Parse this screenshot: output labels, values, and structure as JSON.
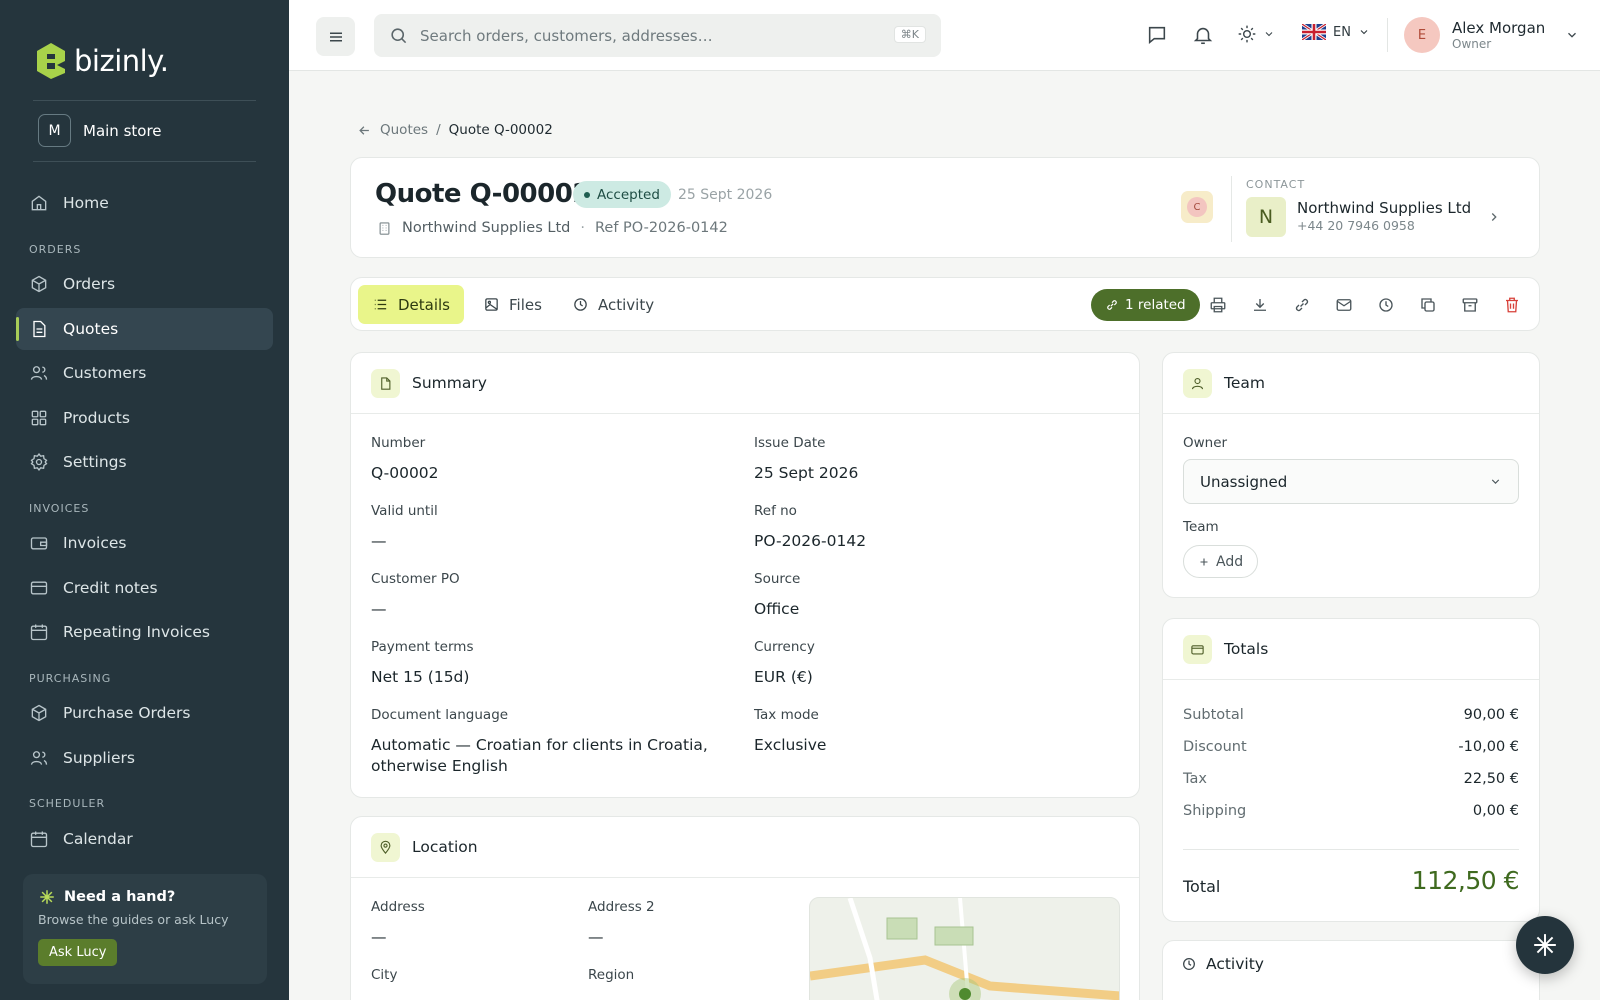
{
  "sidebar": {
    "brand": "bizinly.",
    "store": {
      "initial": "M",
      "name": "Main store"
    },
    "home": "Home",
    "sections": {
      "orders": "ORDERS",
      "invoices": "INVOICES",
      "purchasing": "PURCHASING",
      "scheduler": "SCHEDULER"
    },
    "items": {
      "orders": "Orders",
      "quotes": "Quotes",
      "customers": "Customers",
      "products": "Products",
      "settings": "Settings",
      "invoices": "Invoices",
      "credit_notes": "Credit notes",
      "repeating_invoices": "Repeating Invoices",
      "purchase_orders": "Purchase Orders",
      "suppliers": "Suppliers",
      "calendar": "Calendar"
    },
    "active_item": "Quotes",
    "help": {
      "title": "Need a hand?",
      "subtitle": "Browse the guides or ask Lucy",
      "button": "Ask Lucy"
    }
  },
  "topbar": {
    "search_placeholder": "Search orders, customers, addresses…",
    "search_shortcut": "⌘K",
    "language": "EN",
    "user": {
      "initial": "E",
      "name": "Alex Morgan",
      "role": "Owner"
    }
  },
  "breadcrumb": {
    "parent": "Quotes",
    "separator": "/",
    "current": "Quote Q-00002"
  },
  "quote": {
    "title": "Quote Q-00002",
    "status": "Accepted",
    "date": "25 Sept 2026",
    "company": "Northwind Supplies Ltd",
    "separator": "·",
    "reference": "Ref PO-2026-0142",
    "creator_initial": "C"
  },
  "contact": {
    "label": "CONTACT",
    "initial": "N",
    "name": "Northwind Supplies Ltd",
    "phone": "+44 20 7946 0958"
  },
  "tabs": {
    "details": "Details",
    "files": "Files",
    "activity": "Activity",
    "active": "Details"
  },
  "actions": {
    "related": "1 related",
    "icons": [
      "printer-icon",
      "download-icon",
      "link-icon",
      "mail-icon",
      "clock-icon",
      "copy-icon",
      "archive-icon",
      "trash-icon"
    ]
  },
  "summary": {
    "title": "Summary",
    "fields": {
      "number": {
        "label": "Number",
        "value": "Q-00002"
      },
      "issue_date": {
        "label": "Issue Date",
        "value": "25 Sept 2026"
      },
      "valid_until": {
        "label": "Valid until",
        "value": "—"
      },
      "ref_no": {
        "label": "Ref no",
        "value": "PO-2026-0142"
      },
      "customer_po": {
        "label": "Customer PO",
        "value": "—"
      },
      "source": {
        "label": "Source",
        "value": "Office"
      },
      "payment_terms": {
        "label": "Payment terms",
        "value": "Net 15 (15d)"
      },
      "currency": {
        "label": "Currency",
        "value": "EUR (€)"
      },
      "document_language": {
        "label": "Document language",
        "value": "Automatic — Croatian for clients in Croatia, otherwise English"
      },
      "tax_mode": {
        "label": "Tax mode",
        "value": "Exclusive"
      }
    }
  },
  "location": {
    "title": "Location",
    "fields": {
      "address": {
        "label": "Address",
        "value": "—"
      },
      "address2": {
        "label": "Address 2",
        "value": "—"
      },
      "city": {
        "label": "City"
      },
      "region": {
        "label": "Region"
      }
    }
  },
  "team": {
    "title": "Team",
    "owner_label": "Owner",
    "owner_value": "Unassigned",
    "team_label": "Team",
    "add_label": "Add"
  },
  "totals": {
    "title": "Totals",
    "rows": [
      {
        "label": "Subtotal",
        "value": "90,00 €"
      },
      {
        "label": "Discount",
        "value": "-10,00 €"
      },
      {
        "label": "Tax",
        "value": "22,50 €"
      },
      {
        "label": "Shipping",
        "value": "0,00 €"
      }
    ],
    "total_label": "Total",
    "total_value": "112,50 €"
  },
  "activity_panel": {
    "title": "Activity"
  },
  "colors": {
    "sidebar": "#25353d",
    "accent": "#a8cc58",
    "active_tab": "#e9f58a",
    "related": "#4d6f2a",
    "total": "#3f6a1f",
    "accepted_badge": "#cdeae3"
  }
}
